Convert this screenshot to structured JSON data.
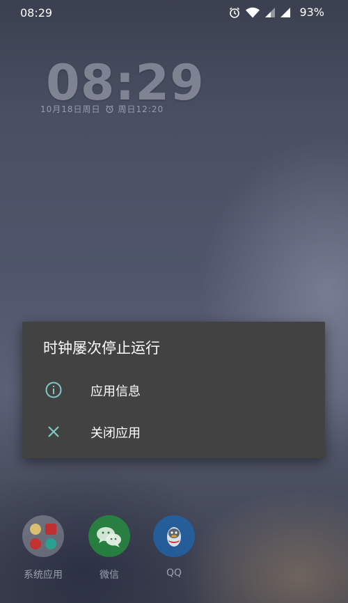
{
  "status_bar": {
    "time": "08:29",
    "battery": "93%",
    "icons": [
      "alarm-icon",
      "wifi-icon",
      "signal-icon",
      "signal-icon"
    ]
  },
  "lockscreen": {
    "clock": "08:29",
    "date": "10月18日周日",
    "next_alarm": "周日12:20"
  },
  "dialog": {
    "title": "时钟屡次停止运行",
    "items": [
      {
        "label": "应用信息",
        "icon": "info-icon"
      },
      {
        "label": "关闭应用",
        "icon": "close-icon"
      }
    ],
    "accent": "#80cbc4"
  },
  "dock": {
    "apps": [
      {
        "label": "系统应用",
        "icon": "folder-icon"
      },
      {
        "label": "微信",
        "icon": "wechat-icon"
      },
      {
        "label": "QQ",
        "icon": "qq-icon"
      }
    ]
  }
}
